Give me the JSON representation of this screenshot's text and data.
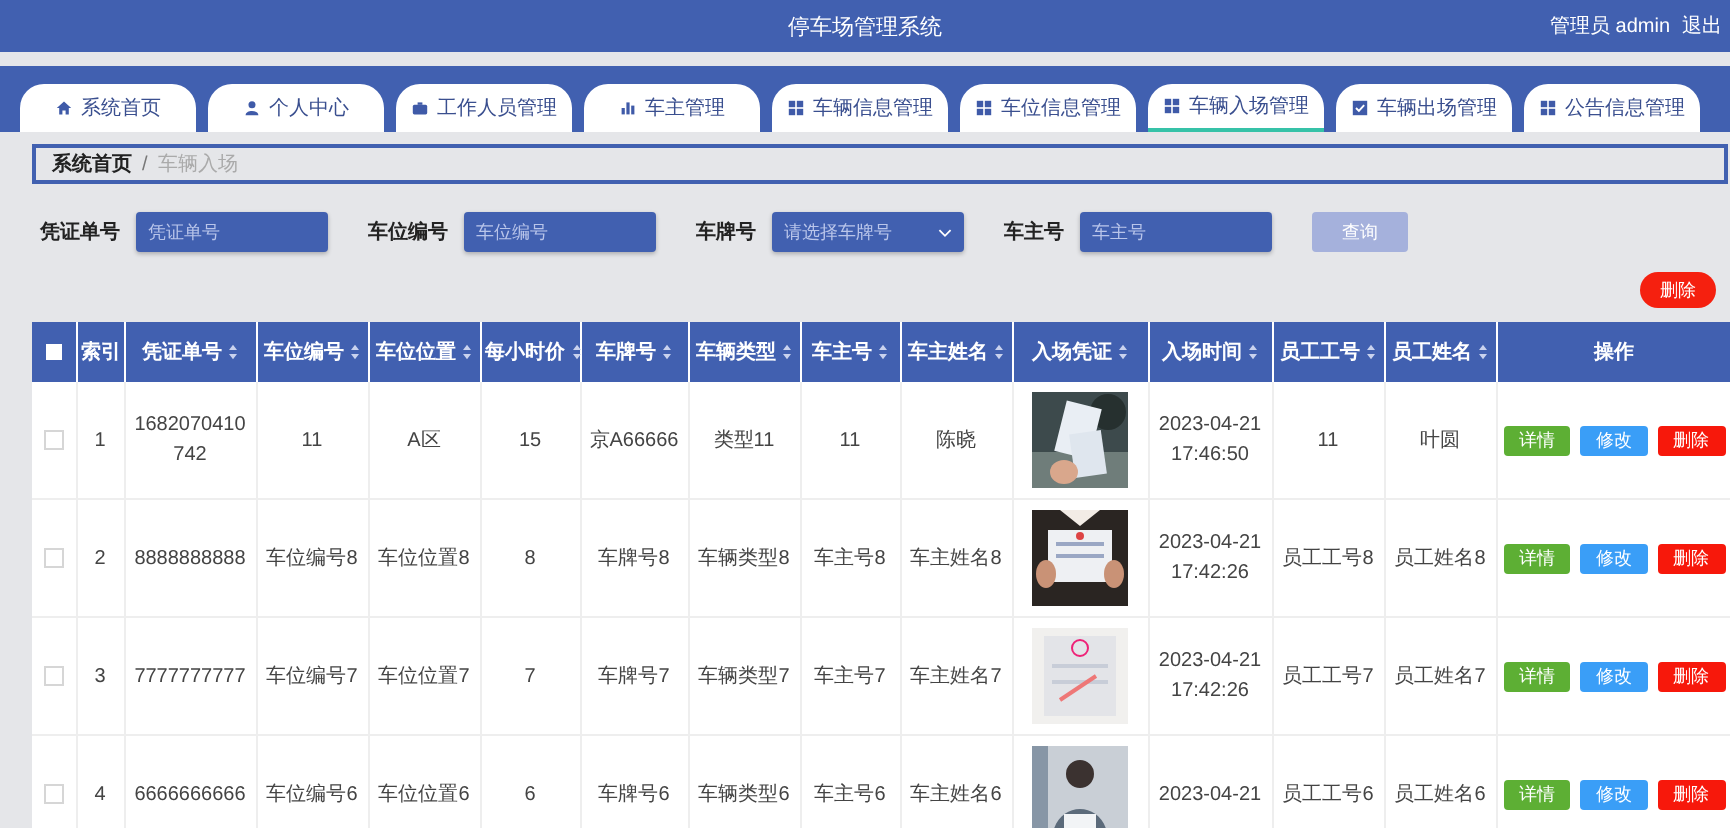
{
  "header": {
    "title": "停车场管理系统",
    "user": "管理员 admin",
    "logout": "退出"
  },
  "tabs": [
    {
      "label": "系统首页",
      "selected": false
    },
    {
      "label": "个人中心",
      "selected": false
    },
    {
      "label": "工作人员管理",
      "selected": false
    },
    {
      "label": "车主管理",
      "selected": false
    },
    {
      "label": "车辆信息管理",
      "selected": false
    },
    {
      "label": "车位信息管理",
      "selected": false
    },
    {
      "label": "车辆入场管理",
      "selected": true
    },
    {
      "label": "车辆出场管理",
      "selected": false
    },
    {
      "label": "公告信息管理",
      "selected": false
    }
  ],
  "breadcrumb": {
    "items": [
      "系统首页",
      "车辆入场"
    ],
    "separator": "/"
  },
  "filters": [
    {
      "label": "凭证单号",
      "placeholder": "凭证单号",
      "kind": "input"
    },
    {
      "label": "车位编号",
      "placeholder": "车位编号",
      "kind": "input"
    },
    {
      "label": "车牌号",
      "placeholder": "请选择车牌号",
      "kind": "select"
    },
    {
      "label": "车主号",
      "placeholder": "车主号",
      "kind": "input"
    }
  ],
  "search_button": "查询",
  "delete_button": "删除",
  "table": {
    "select_all": {
      "checked": false
    },
    "columns": [
      {
        "label": "索引",
        "kind": "index"
      },
      {
        "label": "凭证单号",
        "kind": "text"
      },
      {
        "label": "车位编号",
        "kind": "text"
      },
      {
        "label": "车位位置",
        "kind": "text"
      },
      {
        "label": "每小时价",
        "kind": "text"
      },
      {
        "label": "车牌号",
        "kind": "text"
      },
      {
        "label": "车辆类型",
        "kind": "text"
      },
      {
        "label": "车主号",
        "kind": "text"
      },
      {
        "label": "车主姓名",
        "kind": "text"
      },
      {
        "label": "入场凭证",
        "kind": "picture"
      },
      {
        "label": "入场时间",
        "kind": "text"
      },
      {
        "label": "员工工号",
        "kind": "text"
      },
      {
        "label": "员工姓名",
        "kind": "text"
      },
      {
        "label": "操作",
        "kind": "actions"
      }
    ],
    "rows": [
      {
        "checked": false,
        "cells": [
          "1",
          "1682070410742",
          "11",
          "A区",
          "15",
          "京A66666",
          "类型11",
          "11",
          "陈晓",
          {
            "kind": "picture"
          },
          "2023-04-21 17:46:50",
          "11",
          "叶圆"
        ],
        "actions": [
          {
            "label": "详情",
            "kind": "detail"
          },
          {
            "label": "修改",
            "kind": "edit"
          },
          {
            "label": "删除",
            "kind": "delete"
          }
        ]
      },
      {
        "checked": false,
        "cells": [
          "2",
          "8888888888",
          "车位编号8",
          "车位位置8",
          "8",
          "车牌号8",
          "车辆类型8",
          "车主号8",
          "车主姓名8",
          {
            "kind": "picture"
          },
          "2023-04-21 17:42:26",
          "员工工号8",
          "员工姓名8"
        ],
        "actions": [
          {
            "label": "详情",
            "kind": "detail"
          },
          {
            "label": "修改",
            "kind": "edit"
          },
          {
            "label": "删除",
            "kind": "delete"
          }
        ]
      },
      {
        "checked": false,
        "cells": [
          "3",
          "7777777777",
          "车位编号7",
          "车位位置7",
          "7",
          "车牌号7",
          "车辆类型7",
          "车主号7",
          "车主姓名7",
          {
            "kind": "picture"
          },
          "2023-04-21 17:42:26",
          "员工工号7",
          "员工姓名7"
        ],
        "actions": [
          {
            "label": "详情",
            "kind": "detail"
          },
          {
            "label": "修改",
            "kind": "edit"
          },
          {
            "label": "删除",
            "kind": "delete"
          }
        ]
      },
      {
        "checked": false,
        "cells": [
          "4",
          "6666666666",
          "车位编号6",
          "车位位置6",
          "6",
          "车牌号6",
          "车辆类型6",
          "车主号6",
          "车主姓名6",
          {
            "kind": "picture"
          },
          "2023-04-21",
          "员工工号6",
          "员工姓名6"
        ],
        "actions": [
          {
            "label": "详情",
            "kind": "detail"
          },
          {
            "label": "修改",
            "kind": "edit"
          },
          {
            "label": "删除",
            "kind": "delete"
          }
        ]
      }
    ]
  }
}
